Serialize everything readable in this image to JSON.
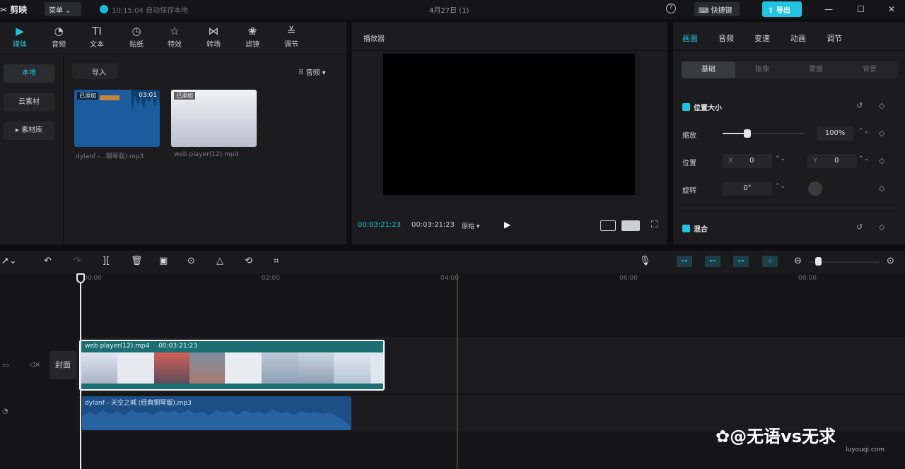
{
  "titlebar": {
    "logo": "✂ 剪映",
    "menu": "菜单 ⌄",
    "save_status": "10:15:04 自动保存本地",
    "title": "4月27日 (1)",
    "help": "?",
    "shortcut": "⌨ 快捷键",
    "export": "⇪ 导出",
    "win_min": "—",
    "win_max": "☐",
    "win_close": "✕"
  },
  "media": {
    "tabs": [
      {
        "icon": "▶",
        "label": "媒体"
      },
      {
        "icon": "◔",
        "label": "音频"
      },
      {
        "icon": "TI",
        "label": "文本"
      },
      {
        "icon": "◷",
        "label": "贴纸"
      },
      {
        "icon": "☆",
        "label": "特效"
      },
      {
        "icon": "⋈",
        "label": "转场"
      },
      {
        "icon": "❀",
        "label": "滤镜"
      },
      {
        "icon": "≚",
        "label": "调节"
      }
    ],
    "side": [
      "本地",
      "云素材",
      "▸ 素材库"
    ],
    "import": "导入",
    "sort": "⠿ 音频 ▾",
    "items": [
      {
        "added": "已添加",
        "duration": "03:01",
        "name": "dylanf -...钢琴版).mp3"
      },
      {
        "added": "已添加",
        "duration": "",
        "name": "web player(12).mp4"
      }
    ]
  },
  "player": {
    "title": "播放器",
    "time_current": "00:03:21:23",
    "time_total": "00:03:21:23",
    "ratio": "原始 ▾",
    "play": "▶"
  },
  "props": {
    "tabs": [
      "画面",
      "音频",
      "变速",
      "动画",
      "调节"
    ],
    "sub_tabs": [
      "基础",
      "抠像",
      "蒙版",
      "背景"
    ],
    "section_position": "位置大小",
    "scale_label": "缩放",
    "scale_value": "100%",
    "scale_level": 0.3,
    "position_label": "位置",
    "x_label": "X",
    "x_value": "0",
    "y_label": "Y",
    "y_value": "0",
    "rotate_label": "旋转",
    "rotate_value": "0°",
    "section_blend": "混合"
  },
  "timeline": {
    "ruler": [
      "00:00",
      "02:00",
      "04:00",
      "06:00",
      "08:00"
    ],
    "cover": "封面",
    "video_clip_name": "web player(12).mp4",
    "video_clip_duration": "00:03:21:23",
    "audio_clip_name": "dylanf - 天空之城 (经典钢琴版).mp3"
  },
  "watermark": {
    "main": "✿@无语vs无求",
    "sub": "luyouqi.com"
  }
}
